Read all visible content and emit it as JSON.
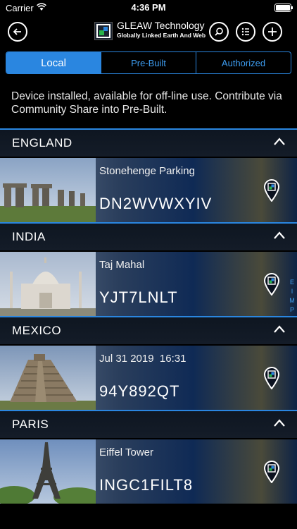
{
  "status": {
    "carrier": "Carrier",
    "time": "4:36 PM"
  },
  "nav": {
    "title": "GLEAW Technology",
    "subtitle": "Globally Linked Earth And Web",
    "back_icon": "back-arrow-icon",
    "search_icon": "search-icon",
    "list_icon": "list-icon",
    "add_icon": "plus-icon"
  },
  "segments": [
    "Local",
    "Pre-Built",
    "Authorized"
  ],
  "info_text": "Device installed, available for off-line use. Contribute via Community Share into Pre-Built.",
  "side_letters": [
    "E",
    "I",
    "M",
    "P"
  ],
  "sections": [
    {
      "name": "ENGLAND",
      "label": "Stonehenge Parking",
      "code": "DN2WVWXYIV"
    },
    {
      "name": "INDIA",
      "label": "Taj Mahal",
      "code": "YJT7LNLT"
    },
    {
      "name": "MEXICO",
      "label": "Jul 31 2019  16:31",
      "code": "94Y892QT"
    },
    {
      "name": "PARIS",
      "label": "Eiffel Tower",
      "code": "INGC1FILT8"
    }
  ],
  "colors": {
    "accent": "#2a86e0",
    "background": "#000000"
  }
}
